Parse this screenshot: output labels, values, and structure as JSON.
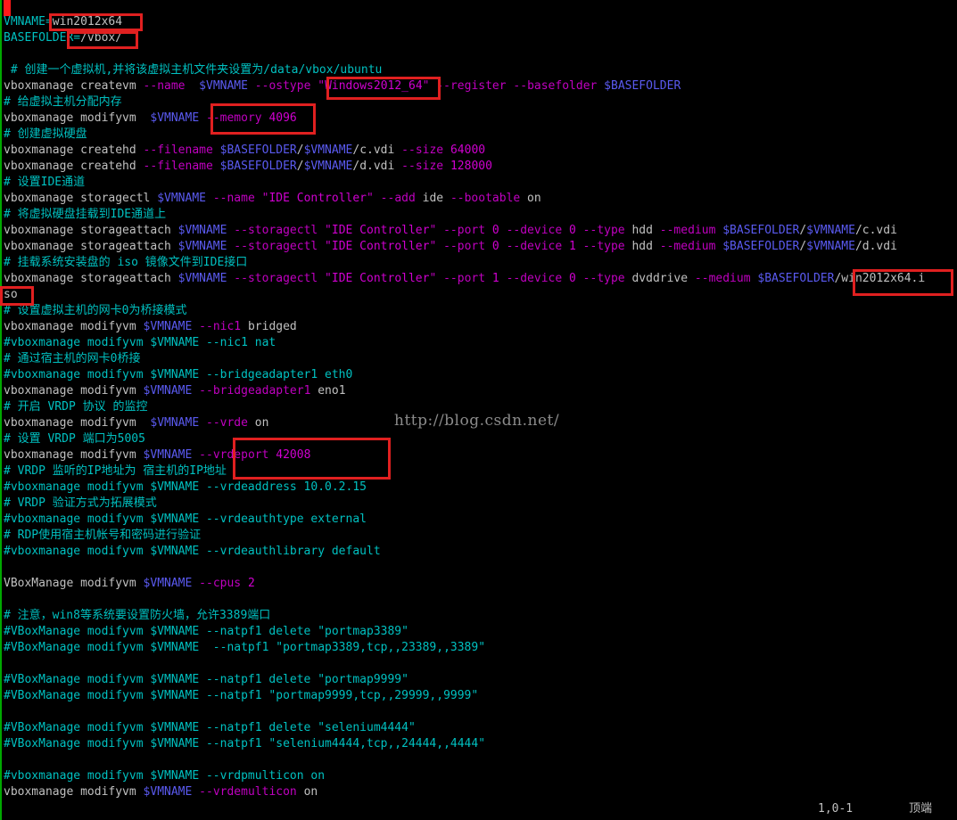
{
  "lines": [
    {
      "row": 0,
      "segs": [
        {
          "t": "VMNAME=",
          "k": "c"
        },
        {
          "t": "win2012x64",
          "k": "p"
        }
      ]
    },
    {
      "row": 1,
      "segs": [
        {
          "t": "BASEFOLDER=",
          "k": "c"
        },
        {
          "t": "/vbox/",
          "k": "p"
        }
      ]
    },
    {
      "row": 2,
      "segs": []
    },
    {
      "row": 3,
      "segs": [
        {
          "t": " # 创建一个虚拟机,并将该虚拟主机文件夹设置为/data/vbox/ubuntu",
          "k": "c"
        }
      ]
    },
    {
      "row": 4,
      "segs": [
        {
          "t": "vboxmanage createvm ",
          "k": "p"
        },
        {
          "t": "--name",
          "k": "o"
        },
        {
          "t": "  ",
          "k": "p"
        },
        {
          "t": "$VMNAME",
          "k": "v"
        },
        {
          "t": " ",
          "k": "p"
        },
        {
          "t": "--ostype",
          "k": "o"
        },
        {
          "t": " \"",
          "k": "o"
        },
        {
          "t": "Windows2012_64",
          "k": "m"
        },
        {
          "t": "\" ",
          "k": "o"
        },
        {
          "t": "--register",
          "k": "o"
        },
        {
          "t": " ",
          "k": "p"
        },
        {
          "t": "--basefolder",
          "k": "o"
        },
        {
          "t": " ",
          "k": "p"
        },
        {
          "t": "$BASEFOLDER",
          "k": "v"
        }
      ]
    },
    {
      "row": 5,
      "segs": [
        {
          "t": "# 给虚拟主机分配内存",
          "k": "c"
        }
      ]
    },
    {
      "row": 6,
      "segs": [
        {
          "t": "vboxmanage modifyvm  ",
          "k": "p"
        },
        {
          "t": "$VMNAME",
          "k": "v"
        },
        {
          "t": " ",
          "k": "p"
        },
        {
          "t": "--memory",
          "k": "o"
        },
        {
          "t": " ",
          "k": "p"
        },
        {
          "t": "4096",
          "k": "m"
        }
      ]
    },
    {
      "row": 7,
      "segs": [
        {
          "t": "# 创建虚拟硬盘",
          "k": "c"
        }
      ]
    },
    {
      "row": 8,
      "segs": [
        {
          "t": "vboxmanage createhd ",
          "k": "p"
        },
        {
          "t": "--filename",
          "k": "o"
        },
        {
          "t": " ",
          "k": "p"
        },
        {
          "t": "$BASEFOLDER",
          "k": "v"
        },
        {
          "t": "/",
          "k": "p"
        },
        {
          "t": "$VMNAME",
          "k": "v"
        },
        {
          "t": "/c.vdi ",
          "k": "p"
        },
        {
          "t": "--size",
          "k": "o"
        },
        {
          "t": " ",
          "k": "p"
        },
        {
          "t": "64000",
          "k": "m"
        }
      ]
    },
    {
      "row": 9,
      "segs": [
        {
          "t": "vboxmanage createhd ",
          "k": "p"
        },
        {
          "t": "--filename",
          "k": "o"
        },
        {
          "t": " ",
          "k": "p"
        },
        {
          "t": "$BASEFOLDER",
          "k": "v"
        },
        {
          "t": "/",
          "k": "p"
        },
        {
          "t": "$VMNAME",
          "k": "v"
        },
        {
          "t": "/d.vdi ",
          "k": "p"
        },
        {
          "t": "--size",
          "k": "o"
        },
        {
          "t": " ",
          "k": "p"
        },
        {
          "t": "128000",
          "k": "m"
        }
      ]
    },
    {
      "row": 10,
      "segs": [
        {
          "t": "# 设置IDE通道",
          "k": "c"
        }
      ]
    },
    {
      "row": 11,
      "segs": [
        {
          "t": "vboxmanage storagectl ",
          "k": "p"
        },
        {
          "t": "$VMNAME",
          "k": "v"
        },
        {
          "t": " ",
          "k": "p"
        },
        {
          "t": "--name",
          "k": "o"
        },
        {
          "t": " \"",
          "k": "o"
        },
        {
          "t": "IDE Controller",
          "k": "m"
        },
        {
          "t": "\" ",
          "k": "o"
        },
        {
          "t": "--add",
          "k": "o"
        },
        {
          "t": " ide ",
          "k": "p"
        },
        {
          "t": "--bootable",
          "k": "o"
        },
        {
          "t": " on",
          "k": "p"
        }
      ]
    },
    {
      "row": 12,
      "segs": [
        {
          "t": "# 将虚拟硬盘挂载到IDE通道上",
          "k": "c"
        }
      ]
    },
    {
      "row": 13,
      "segs": [
        {
          "t": "vboxmanage storageattach ",
          "k": "p"
        },
        {
          "t": "$VMNAME",
          "k": "v"
        },
        {
          "t": " ",
          "k": "p"
        },
        {
          "t": "--storagectl",
          "k": "o"
        },
        {
          "t": " \"",
          "k": "o"
        },
        {
          "t": "IDE Controller",
          "k": "m"
        },
        {
          "t": "\" ",
          "k": "o"
        },
        {
          "t": "--port",
          "k": "o"
        },
        {
          "t": " ",
          "k": "p"
        },
        {
          "t": "0",
          "k": "m"
        },
        {
          "t": " ",
          "k": "p"
        },
        {
          "t": "--device",
          "k": "o"
        },
        {
          "t": " ",
          "k": "p"
        },
        {
          "t": "0",
          "k": "m"
        },
        {
          "t": " ",
          "k": "p"
        },
        {
          "t": "--type",
          "k": "o"
        },
        {
          "t": " hdd ",
          "k": "p"
        },
        {
          "t": "--medium",
          "k": "o"
        },
        {
          "t": " ",
          "k": "p"
        },
        {
          "t": "$BASEFOLDER",
          "k": "v"
        },
        {
          "t": "/",
          "k": "p"
        },
        {
          "t": "$VMNAME",
          "k": "v"
        },
        {
          "t": "/c.vdi",
          "k": "p"
        }
      ]
    },
    {
      "row": 14,
      "segs": [
        {
          "t": "vboxmanage storageattach ",
          "k": "p"
        },
        {
          "t": "$VMNAME",
          "k": "v"
        },
        {
          "t": " ",
          "k": "p"
        },
        {
          "t": "--storagectl",
          "k": "o"
        },
        {
          "t": " \"",
          "k": "o"
        },
        {
          "t": "IDE Controller",
          "k": "m"
        },
        {
          "t": "\" ",
          "k": "o"
        },
        {
          "t": "--port",
          "k": "o"
        },
        {
          "t": " ",
          "k": "p"
        },
        {
          "t": "0",
          "k": "m"
        },
        {
          "t": " ",
          "k": "p"
        },
        {
          "t": "--device",
          "k": "o"
        },
        {
          "t": " ",
          "k": "p"
        },
        {
          "t": "1",
          "k": "m"
        },
        {
          "t": " ",
          "k": "p"
        },
        {
          "t": "--type",
          "k": "o"
        },
        {
          "t": " hdd ",
          "k": "p"
        },
        {
          "t": "--medium",
          "k": "o"
        },
        {
          "t": " ",
          "k": "p"
        },
        {
          "t": "$BASEFOLDER",
          "k": "v"
        },
        {
          "t": "/",
          "k": "p"
        },
        {
          "t": "$VMNAME",
          "k": "v"
        },
        {
          "t": "/d.vdi",
          "k": "p"
        }
      ]
    },
    {
      "row": 15,
      "segs": [
        {
          "t": "# 挂载系统安装盘的 iso 镜像文件到IDE接口",
          "k": "c"
        }
      ]
    },
    {
      "row": 16,
      "segs": [
        {
          "t": "vboxmanage storageattach ",
          "k": "p"
        },
        {
          "t": "$VMNAME",
          "k": "v"
        },
        {
          "t": " ",
          "k": "p"
        },
        {
          "t": "--storagectl",
          "k": "o"
        },
        {
          "t": " \"",
          "k": "o"
        },
        {
          "t": "IDE Controller",
          "k": "m"
        },
        {
          "t": "\" ",
          "k": "o"
        },
        {
          "t": "--port",
          "k": "o"
        },
        {
          "t": " ",
          "k": "p"
        },
        {
          "t": "1",
          "k": "m"
        },
        {
          "t": " ",
          "k": "p"
        },
        {
          "t": "--device",
          "k": "o"
        },
        {
          "t": " ",
          "k": "p"
        },
        {
          "t": "0",
          "k": "m"
        },
        {
          "t": " ",
          "k": "p"
        },
        {
          "t": "--type",
          "k": "o"
        },
        {
          "t": " dvddrive ",
          "k": "p"
        },
        {
          "t": "--medium",
          "k": "o"
        },
        {
          "t": " ",
          "k": "p"
        },
        {
          "t": "$BASEFOLDER",
          "k": "v"
        },
        {
          "t": "/win2012x64.i",
          "k": "p"
        }
      ]
    },
    {
      "row": 17,
      "segs": [
        {
          "t": "so",
          "k": "p"
        }
      ]
    },
    {
      "row": 18,
      "segs": [
        {
          "t": "# 设置虚拟主机的网卡0为桥接模式",
          "k": "c"
        }
      ]
    },
    {
      "row": 19,
      "segs": [
        {
          "t": "vboxmanage modifyvm ",
          "k": "p"
        },
        {
          "t": "$VMNAME",
          "k": "v"
        },
        {
          "t": " ",
          "k": "p"
        },
        {
          "t": "--nic1",
          "k": "o"
        },
        {
          "t": " bridged",
          "k": "p"
        }
      ]
    },
    {
      "row": 20,
      "segs": [
        {
          "t": "#vboxmanage modifyvm $VMNAME --nic1 nat",
          "k": "c"
        }
      ]
    },
    {
      "row": 21,
      "segs": [
        {
          "t": "# 通过宿主机的网卡0桥接",
          "k": "c"
        }
      ]
    },
    {
      "row": 22,
      "segs": [
        {
          "t": "#vboxmanage modifyvm $VMNAME --bridgeadapter1 eth0",
          "k": "c"
        }
      ]
    },
    {
      "row": 23,
      "segs": [
        {
          "t": "vboxmanage modifyvm ",
          "k": "p"
        },
        {
          "t": "$VMNAME",
          "k": "v"
        },
        {
          "t": " ",
          "k": "p"
        },
        {
          "t": "--bridgeadapter1",
          "k": "o"
        },
        {
          "t": " eno1",
          "k": "p"
        }
      ]
    },
    {
      "row": 24,
      "segs": [
        {
          "t": "# 开启 VRDP 协议 的监控",
          "k": "c"
        }
      ]
    },
    {
      "row": 25,
      "segs": [
        {
          "t": "vboxmanage modifyvm  ",
          "k": "p"
        },
        {
          "t": "$VMNAME",
          "k": "v"
        },
        {
          "t": " ",
          "k": "p"
        },
        {
          "t": "--vrde",
          "k": "o"
        },
        {
          "t": " on",
          "k": "p"
        }
      ]
    },
    {
      "row": 26,
      "segs": [
        {
          "t": "# 设置 VRDP 端口为5005",
          "k": "c"
        }
      ]
    },
    {
      "row": 27,
      "segs": [
        {
          "t": "vboxmanage modifyvm ",
          "k": "p"
        },
        {
          "t": "$VMNAME",
          "k": "v"
        },
        {
          "t": " ",
          "k": "p"
        },
        {
          "t": "--vrdeport",
          "k": "o"
        },
        {
          "t": " ",
          "k": "p"
        },
        {
          "t": "42008",
          "k": "m"
        }
      ]
    },
    {
      "row": 28,
      "segs": [
        {
          "t": "# VRDP 监听的IP地址为 宿主机的IP地址",
          "k": "c"
        }
      ]
    },
    {
      "row": 29,
      "segs": [
        {
          "t": "#vboxmanage modifyvm $VMNAME --vrdeaddress 10.0.2.15",
          "k": "c"
        }
      ]
    },
    {
      "row": 30,
      "segs": [
        {
          "t": "# VRDP 验证方式为拓展模式",
          "k": "c"
        }
      ]
    },
    {
      "row": 31,
      "segs": [
        {
          "t": "#vboxmanage modifyvm $VMNAME --vrdeauthtype external",
          "k": "c"
        }
      ]
    },
    {
      "row": 32,
      "segs": [
        {
          "t": "# RDP使用宿主机帐号和密码进行验证",
          "k": "c"
        }
      ]
    },
    {
      "row": 33,
      "segs": [
        {
          "t": "#vboxmanage modifyvm $VMNAME --vrdeauthlibrary default",
          "k": "c"
        }
      ]
    },
    {
      "row": 34,
      "segs": []
    },
    {
      "row": 35,
      "segs": [
        {
          "t": "VBoxManage modifyvm ",
          "k": "p"
        },
        {
          "t": "$VMNAME",
          "k": "v"
        },
        {
          "t": " ",
          "k": "p"
        },
        {
          "t": "--cpus",
          "k": "o"
        },
        {
          "t": " ",
          "k": "p"
        },
        {
          "t": "2",
          "k": "m"
        }
      ]
    },
    {
      "row": 36,
      "segs": []
    },
    {
      "row": 37,
      "segs": [
        {
          "t": "# 注意，win8等系统要设置防火墙，允许3389端口",
          "k": "c"
        }
      ]
    },
    {
      "row": 38,
      "segs": [
        {
          "t": "#VBoxManage modifyvm $VMNAME --natpf1 delete \"portmap3389\"",
          "k": "c"
        }
      ]
    },
    {
      "row": 39,
      "segs": [
        {
          "t": "#VBoxManage modifyvm $VMNAME  --natpf1 \"portmap3389,tcp,,23389,,3389\"",
          "k": "c"
        }
      ]
    },
    {
      "row": 40,
      "segs": []
    },
    {
      "row": 41,
      "segs": [
        {
          "t": "#VBoxManage modifyvm $VMNAME --natpf1 delete \"portmap9999\"",
          "k": "c"
        }
      ]
    },
    {
      "row": 42,
      "segs": [
        {
          "t": "#VBoxManage modifyvm $VMNAME --natpf1 \"portmap9999,tcp,,29999,,9999\"",
          "k": "c"
        }
      ]
    },
    {
      "row": 43,
      "segs": []
    },
    {
      "row": 44,
      "segs": [
        {
          "t": "#VBoxManage modifyvm $VMNAME --natpf1 delete \"selenium4444\"",
          "k": "c"
        }
      ]
    },
    {
      "row": 45,
      "segs": [
        {
          "t": "#VBoxManage modifyvm $VMNAME --natpf1 \"selenium4444,tcp,,24444,,4444\"",
          "k": "c"
        }
      ]
    },
    {
      "row": 46,
      "segs": []
    },
    {
      "row": 47,
      "segs": [
        {
          "t": "#vboxmanage modifyvm $VMNAME --vrdpmulticon on",
          "k": "c"
        }
      ]
    },
    {
      "row": 48,
      "segs": [
        {
          "t": "vboxmanage modifyvm ",
          "k": "p"
        },
        {
          "t": "$VMNAME",
          "k": "v"
        },
        {
          "t": " ",
          "k": "p"
        },
        {
          "t": "--vrdemulticon",
          "k": "o"
        },
        {
          "t": " on",
          "k": "p"
        }
      ]
    }
  ],
  "watermark": "http://blog.csdn.net/",
  "status": {
    "position": "1,0-1",
    "scroll": "顶端"
  },
  "colors": {
    "background": "#000000",
    "plain": "#c0c0c0",
    "comment": "#00c0c0",
    "option": "#c000c0",
    "variable": "#5a5af0",
    "number": "#d000d0",
    "highlight": "#e02020"
  }
}
